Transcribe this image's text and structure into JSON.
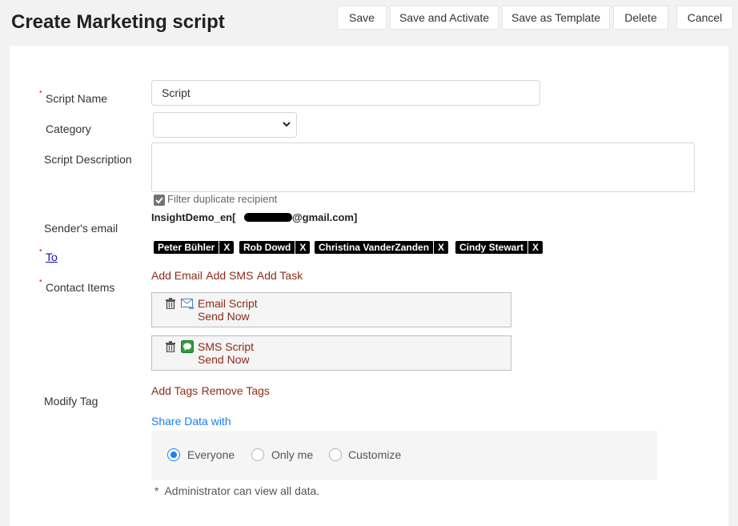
{
  "page": {
    "title": "Create Marketing script"
  },
  "toolbar": {
    "save": "Save",
    "save_activate": "Save and Activate",
    "save_template": "Save as Template",
    "delete": "Delete",
    "cancel": "Cancel"
  },
  "form": {
    "script_name": {
      "label": "Script Name",
      "value": "Script"
    },
    "category": {
      "label": "Category",
      "value": ""
    },
    "description": {
      "label": "Script Description",
      "value": ""
    },
    "filter_duplicate": {
      "label": "Filter duplicate recipient",
      "checked": true
    },
    "sender_email": {
      "label": "Sender's email",
      "value_prefix": "InsightDemo_en[",
      "value_suffix": "@gmail.com]"
    },
    "to": {
      "label": "To",
      "recipients": [
        {
          "name": "Peter Bühler",
          "remove": "X"
        },
        {
          "name": "Rob Dowd",
          "remove": "X"
        },
        {
          "name": "Christina VanderZanden",
          "remove": "X"
        },
        {
          "name": "Cindy Stewart",
          "remove": "X"
        }
      ]
    },
    "contact_items": {
      "label": "Contact Items",
      "actions": [
        "Add Email",
        "Add SMS",
        "Add Task"
      ],
      "items": [
        {
          "title": "Email Script",
          "action": "Send Now",
          "icon": "email-icon"
        },
        {
          "title": "SMS Script",
          "action": "Send Now",
          "icon": "sms-icon"
        }
      ]
    },
    "modify_tag": {
      "label": "Modify Tag",
      "actions": [
        "Add Tags",
        "Remove Tags"
      ]
    },
    "share": {
      "label": "Share Data with",
      "options": [
        "Everyone",
        "Only me",
        "Customize"
      ],
      "selected": "Everyone",
      "note": "*  Administrator can view all data."
    }
  },
  "colors": {
    "accent_red": "#8b2c17",
    "accent_blue": "#1a7ff3",
    "required": "#d9534f"
  }
}
